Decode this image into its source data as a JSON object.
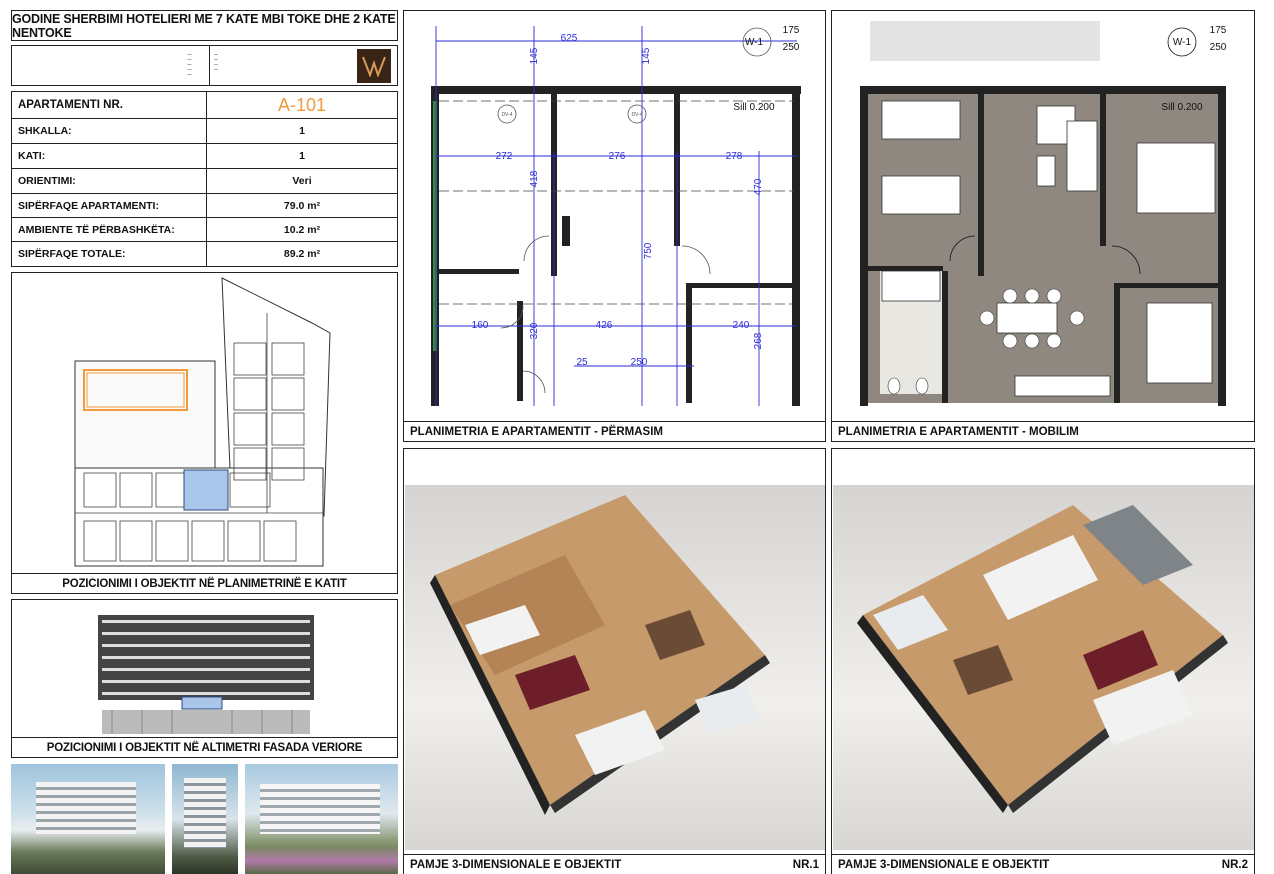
{
  "header": {
    "title": "GODINE SHERBIMI HOTELIERI ME 7 KATE MBI TOKE DHE 2 KATE NENTOKE"
  },
  "info": {
    "apartment_label": "APARTAMENTI NR.",
    "apartment_value": "A-101",
    "rows": [
      {
        "label": "SHKALLA:",
        "value": "1"
      },
      {
        "label": "KATI:",
        "value": "1"
      },
      {
        "label": "ORIENTIMI:",
        "value": "Veri"
      },
      {
        "label": "SIPËRFAQE APARTAMENTI:",
        "value": "79.0 m²"
      },
      {
        "label": "AMBIENTE TË PËRBASHKËTA:",
        "value": "10.2 m²"
      },
      {
        "label": "SIPËRFAQE TOTALE:",
        "value": "89.2 m²"
      }
    ]
  },
  "panels": {
    "floor_position": "POZICIONIMI I OBJEKTIT NË PLANIMETRINË E KATIT",
    "facade_position": "POZICIONIMI I OBJEKTIT NË ALTIMETRI FASADA VERIORE",
    "plan_dimensions": "PLANIMETRIA E APARTAMENTIT - PËRMASIM",
    "plan_furniture": "PLANIMETRIA E APARTAMENTIT - MOBILIM",
    "view3d_1": "PAMJE 3-DIMENSIONALE E OBJEKTIT",
    "view3d_1_nr": "NR.1",
    "view3d_2": "PAMJE 3-DIMENSIONALE E OBJEKTIT",
    "view3d_2_nr": "NR.2"
  },
  "dimensions": {
    "top": "625",
    "left_145": "145",
    "right_145": "145",
    "d272": "272",
    "d276": "276",
    "d278": "278",
    "d418": "418",
    "d470": "470",
    "d750": "750",
    "d160": "160",
    "d426": "426",
    "d240": "240",
    "d320": "320",
    "d268": "268",
    "d250": "250",
    "d25": "25",
    "w1": "W-1",
    "h175": "175",
    "h250": "250",
    "sill": "Sill 0.200",
    "dv4": "DV-4"
  },
  "colors": {
    "accent": "#f39a3c",
    "dim_blue": "#2b2bd8",
    "floor": "#8f8880"
  }
}
